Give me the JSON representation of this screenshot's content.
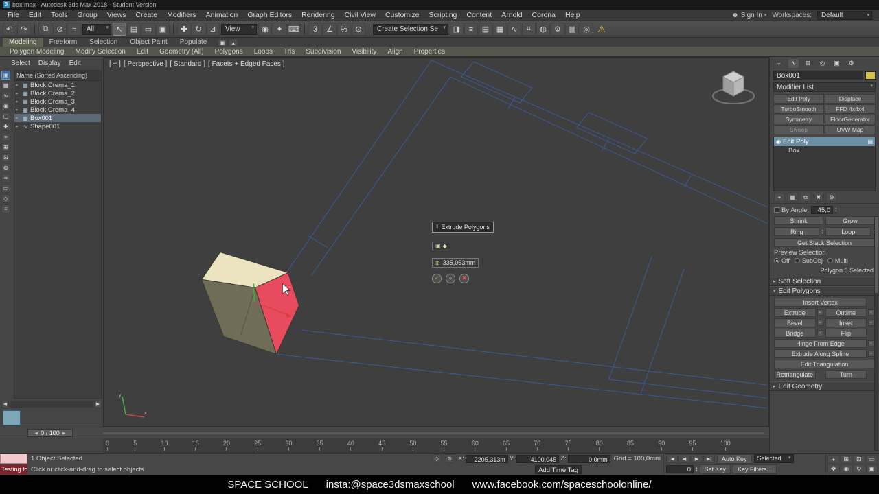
{
  "icons": {
    "caret": "▾",
    "collapsed_arrow": "▸",
    "expanded_arrow": "▾",
    "spin_up": "▴",
    "spin_down": "▾",
    "left_arrow": "◀",
    "right_arrow": "▶",
    "grip": "‖"
  },
  "titlebar": {
    "app_icon": "3",
    "title": "box.max - Autodesk 3ds Max 2018 - Student Version"
  },
  "menubar": {
    "items": [
      "File",
      "Edit",
      "Tools",
      "Group",
      "Views",
      "Create",
      "Modifiers",
      "Animation",
      "Graph Editors",
      "Rendering",
      "Civil View",
      "Customize",
      "Scripting",
      "Content",
      "Arnold",
      "Corona",
      "Help"
    ],
    "person_glyph": "☻",
    "signin_label": "Sign In",
    "workspaces_label": "Workspaces:",
    "workspaces_value": "Default"
  },
  "toolbar": {
    "history": [
      {
        "name": "undo-icon",
        "glyph": "↶"
      },
      {
        "name": "redo-icon",
        "glyph": "↷"
      }
    ],
    "link": [
      {
        "name": "select-and-link-icon",
        "glyph": "⧉"
      },
      {
        "name": "unlink-selection-icon",
        "glyph": "⊘"
      },
      {
        "name": "bind-to-spacewarp-icon",
        "glyph": "≈"
      }
    ],
    "filter_value": "All",
    "select_tools": [
      {
        "name": "select-object-icon",
        "glyph": "↖",
        "selected": "true"
      },
      {
        "name": "select-by-name-icon",
        "glyph": "▤"
      },
      {
        "name": "rectangular-selection-region-icon",
        "glyph": "▭"
      },
      {
        "name": "window-crossing-icon",
        "glyph": "▣"
      }
    ],
    "transform_tools": [
      {
        "name": "select-and-move-icon",
        "glyph": "✚"
      },
      {
        "name": "select-and-rotate-icon",
        "glyph": "↻"
      },
      {
        "name": "select-and-scale-icon",
        "glyph": "⊿"
      }
    ],
    "ref_coord_value": "View",
    "pivot_tools": [
      {
        "name": "use-pivot-point-center-icon",
        "glyph": "◉"
      },
      {
        "name": "select-and-manipulate-icon",
        "glyph": "✦"
      },
      {
        "name": "keyboard-shortcut-override-icon",
        "glyph": "⌨"
      }
    ],
    "snap_tools": [
      {
        "name": "snap-toggle-3d-icon",
        "glyph": "3"
      },
      {
        "name": "angle-snap-icon",
        "glyph": "∠"
      },
      {
        "name": "percent-snap-icon",
        "glyph": "%"
      },
      {
        "name": "spinner-snap-icon",
        "glyph": "⊙"
      }
    ],
    "named_selection_value": "Create Selection Se",
    "right_tools": [
      {
        "name": "mirror-icon",
        "glyph": "◨"
      },
      {
        "name": "align-icon",
        "glyph": "≡"
      },
      {
        "name": "layer-manager-icon",
        "glyph": "▤"
      },
      {
        "name": "ribbon-toggle-icon",
        "glyph": "▦"
      },
      {
        "name": "curve-editor-icon",
        "glyph": "∿"
      },
      {
        "name": "schematic-view-icon",
        "glyph": "⌗"
      },
      {
        "name": "material-editor-icon",
        "glyph": "◍"
      },
      {
        "name": "render-setup-icon",
        "glyph": "⚙"
      },
      {
        "name": "rendered-frame-window-icon",
        "glyph": "▥"
      },
      {
        "name": "render-production-icon",
        "glyph": "◎"
      }
    ],
    "warning_glyph": "⚠"
  },
  "ribbon": {
    "tabs": [
      {
        "label": "Modeling",
        "selected": "true"
      },
      {
        "label": "Freeform"
      },
      {
        "label": "Selection"
      },
      {
        "label": "Object Paint"
      },
      {
        "label": "Populate"
      }
    ],
    "mini": [
      {
        "name": "ribbon-config-icon",
        "glyph": "▣"
      },
      {
        "name": "ribbon-minimize-icon",
        "glyph": "▴"
      }
    ],
    "groups": [
      "Polygon Modeling",
      "Modify Selection",
      "Edit",
      "Geometry (All)",
      "Polygons",
      "Loops",
      "Tris",
      "Subdivision",
      "Visibility",
      "Align",
      "Properties"
    ]
  },
  "explorer": {
    "buttons": [
      "Select",
      "Display",
      "Edit"
    ],
    "header": "Name (Sorted Ascending)",
    "tools": [
      {
        "name": "explorer-select-icon",
        "glyph": "▣",
        "selected": "true"
      },
      {
        "name": "explorer-geometry-filter-icon",
        "glyph": "▦"
      },
      {
        "name": "explorer-shapes-filter-icon",
        "glyph": "∿"
      },
      {
        "name": "explorer-lights-filter-icon",
        "glyph": "◉"
      },
      {
        "name": "explorer-cameras-filter-icon",
        "glyph": "▢"
      },
      {
        "name": "explorer-helpers-filter-icon",
        "glyph": "✚"
      },
      {
        "name": "explorer-spacewarps-filter-icon",
        "glyph": "≈"
      },
      {
        "name": "explorer-groups-filter-icon",
        "glyph": "⊞"
      },
      {
        "name": "explorer-xrefs-filter-icon",
        "glyph": "⊡"
      },
      {
        "name": "explorer-materials-filter-icon",
        "glyph": "◍"
      },
      {
        "name": "explorer-bones-filter-icon",
        "glyph": "⌗"
      },
      {
        "name": "explorer-containers-filter-icon",
        "glyph": "▭"
      },
      {
        "name": "explorer-frozen-filter-icon",
        "glyph": "◇"
      },
      {
        "name": "explorer-hidden-filter-icon",
        "glyph": "≡"
      }
    ],
    "items": [
      {
        "label": "Block:Crema_1",
        "glyph": "▦"
      },
      {
        "label": "Block:Crema_2",
        "glyph": "▦"
      },
      {
        "label": "Block:Crema_3",
        "glyph": "▦"
      },
      {
        "label": "Block:Crema_4",
        "glyph": "▦"
      },
      {
        "label": "Box001",
        "glyph": "▦",
        "selected": "true"
      },
      {
        "label": "Shape001",
        "glyph": "∿"
      }
    ],
    "flyout_glyph": "▶"
  },
  "viewport": {
    "label_plus": "[ + ]",
    "label_pov": "[ Perspective ]",
    "label_style": "[ Standard ]",
    "label_shading": "[ Facets + Edged Faces ]",
    "axis_x": "x",
    "axis_y": "y",
    "caddy": {
      "title": "Extrude Polygons",
      "toggle_a": "▣",
      "toggle_b": "◆",
      "height_icon": "⊞",
      "height_value": "335,053mm",
      "ok_glyph": "✓",
      "apply_glyph": "+",
      "cancel_glyph": "✖"
    }
  },
  "command_panel": {
    "tabs": [
      {
        "name": "create-tab-icon",
        "glyph": "+"
      },
      {
        "name": "modify-tab-icon",
        "glyph": "∿",
        "selected": "true"
      },
      {
        "name": "hierarchy-tab-icon",
        "glyph": "⊞"
      },
      {
        "name": "motion-tab-icon",
        "glyph": "◎"
      },
      {
        "name": "display-tab-icon",
        "glyph": "▣"
      },
      {
        "name": "utilities-tab-icon",
        "glyph": "⚙"
      }
    ],
    "object_name": "Box001",
    "modifier_list_label": "Modifier List",
    "modifier_buttons": [
      {
        "label": "Edit Poly"
      },
      {
        "label": "Displace"
      },
      {
        "label": "TurboSmooth"
      },
      {
        "label": "FFD 4x4x4"
      },
      {
        "label": "Symmetry"
      },
      {
        "label": "FloorGenerator"
      },
      {
        "label": "Sweep",
        "disabled": "true"
      },
      {
        "label": "UVW Map"
      }
    ],
    "stack": [
      {
        "label": "Edit Poly",
        "glyph": "◉",
        "right": "▤",
        "selected": "true"
      },
      {
        "label": "Box",
        "glyph": "",
        "right": "",
        "indent": "true"
      }
    ],
    "stack_tools": [
      {
        "name": "pin-stack-icon",
        "glyph": "⌖"
      },
      {
        "name": "show-end-result-icon",
        "glyph": "▦"
      },
      {
        "name": "make-unique-icon",
        "glyph": "⧉"
      },
      {
        "name": "remove-modifier-icon",
        "glyph": "✖"
      },
      {
        "name": "configure-modifier-sets-icon",
        "glyph": "⚙"
      }
    ],
    "params": {
      "by_angle_label": "By Angle:",
      "by_angle_value": "45,0",
      "shrink": "Shrink",
      "grow": "Grow",
      "ring": "Ring",
      "loop": "Loop",
      "get_stack": "Get Stack Selection",
      "preview_label": "Preview Selection",
      "preview_off": "Off",
      "preview_subobj": "SubObj",
      "preview_multi": "Multi",
      "selection_status": "Polygon 5 Selected"
    },
    "rollouts": {
      "soft_selection": "Soft Selection",
      "edit_polygons": "Edit Polygons",
      "edit_geometry": "Edit Geometry"
    },
    "edit_polygons": {
      "insert_vertex": "Insert Vertex",
      "extrude": "Extrude",
      "outline": "Outline",
      "bevel": "Bevel",
      "inset": "Inset",
      "bridge": "Bridge",
      "flip": "Flip",
      "hinge": "Hinge From Edge",
      "extrude_spline": "Extrude Along Spline",
      "edit_triangulation": "Edit Triangulation",
      "retriangulate": "Retriangulate",
      "turn": "Turn",
      "settings_glyph": "▫"
    }
  },
  "timeline": {
    "slider_value": "0 / 100",
    "ticks": [
      "0",
      "5",
      "10",
      "15",
      "20",
      "25",
      "30",
      "35",
      "40",
      "45",
      "50",
      "55",
      "60",
      "65",
      "70",
      "75",
      "80",
      "85",
      "90",
      "95",
      "100"
    ]
  },
  "statusbar": {
    "listener_text": "Testing fo",
    "selected_status": "1 Object Selected",
    "prompt": "Click or click-and-drag to select objects",
    "isolate_glyph": "◇",
    "lock_glyph": "⊘",
    "x_label": "X:",
    "x_value": "2205,313m",
    "y_label": "Y:",
    "y_value": "-4100,045",
    "z_label": "Z:",
    "z_value": "0,0mm",
    "grid_value": "Grid = 100,0mm",
    "add_time_tag": "Add Time Tag",
    "playback": [
      {
        "name": "go-to-start-icon",
        "glyph": "|◀"
      },
      {
        "name": "previous-frame-icon",
        "glyph": "◀"
      },
      {
        "name": "play-icon",
        "glyph": "▶"
      },
      {
        "name": "go-to-end-icon",
        "glyph": "▶|"
      }
    ],
    "auto_key": "Auto Key",
    "selected_set": "Selected",
    "set_key": "Set Key",
    "key_filters": "Key Filters...",
    "time_value": "0",
    "nav": [
      {
        "name": "zoom-icon",
        "glyph": "+"
      },
      {
        "name": "zoom-all-icon",
        "glyph": "⊞"
      },
      {
        "name": "zoom-extents-icon",
        "glyph": "⊡"
      },
      {
        "name": "zoom-region-icon",
        "glyph": "▭"
      },
      {
        "name": "pan-icon",
        "glyph": "✥"
      },
      {
        "name": "walk-through-icon",
        "glyph": "◉"
      },
      {
        "name": "orbit-icon",
        "glyph": "↻"
      },
      {
        "name": "maximize-viewport-icon",
        "glyph": "▣"
      }
    ]
  },
  "footer": {
    "brand": "SPACE SCHOOL",
    "insta": "insta:@space3dsmaxschool",
    "web": "www.facebook.com/spaceschoolonline/"
  }
}
